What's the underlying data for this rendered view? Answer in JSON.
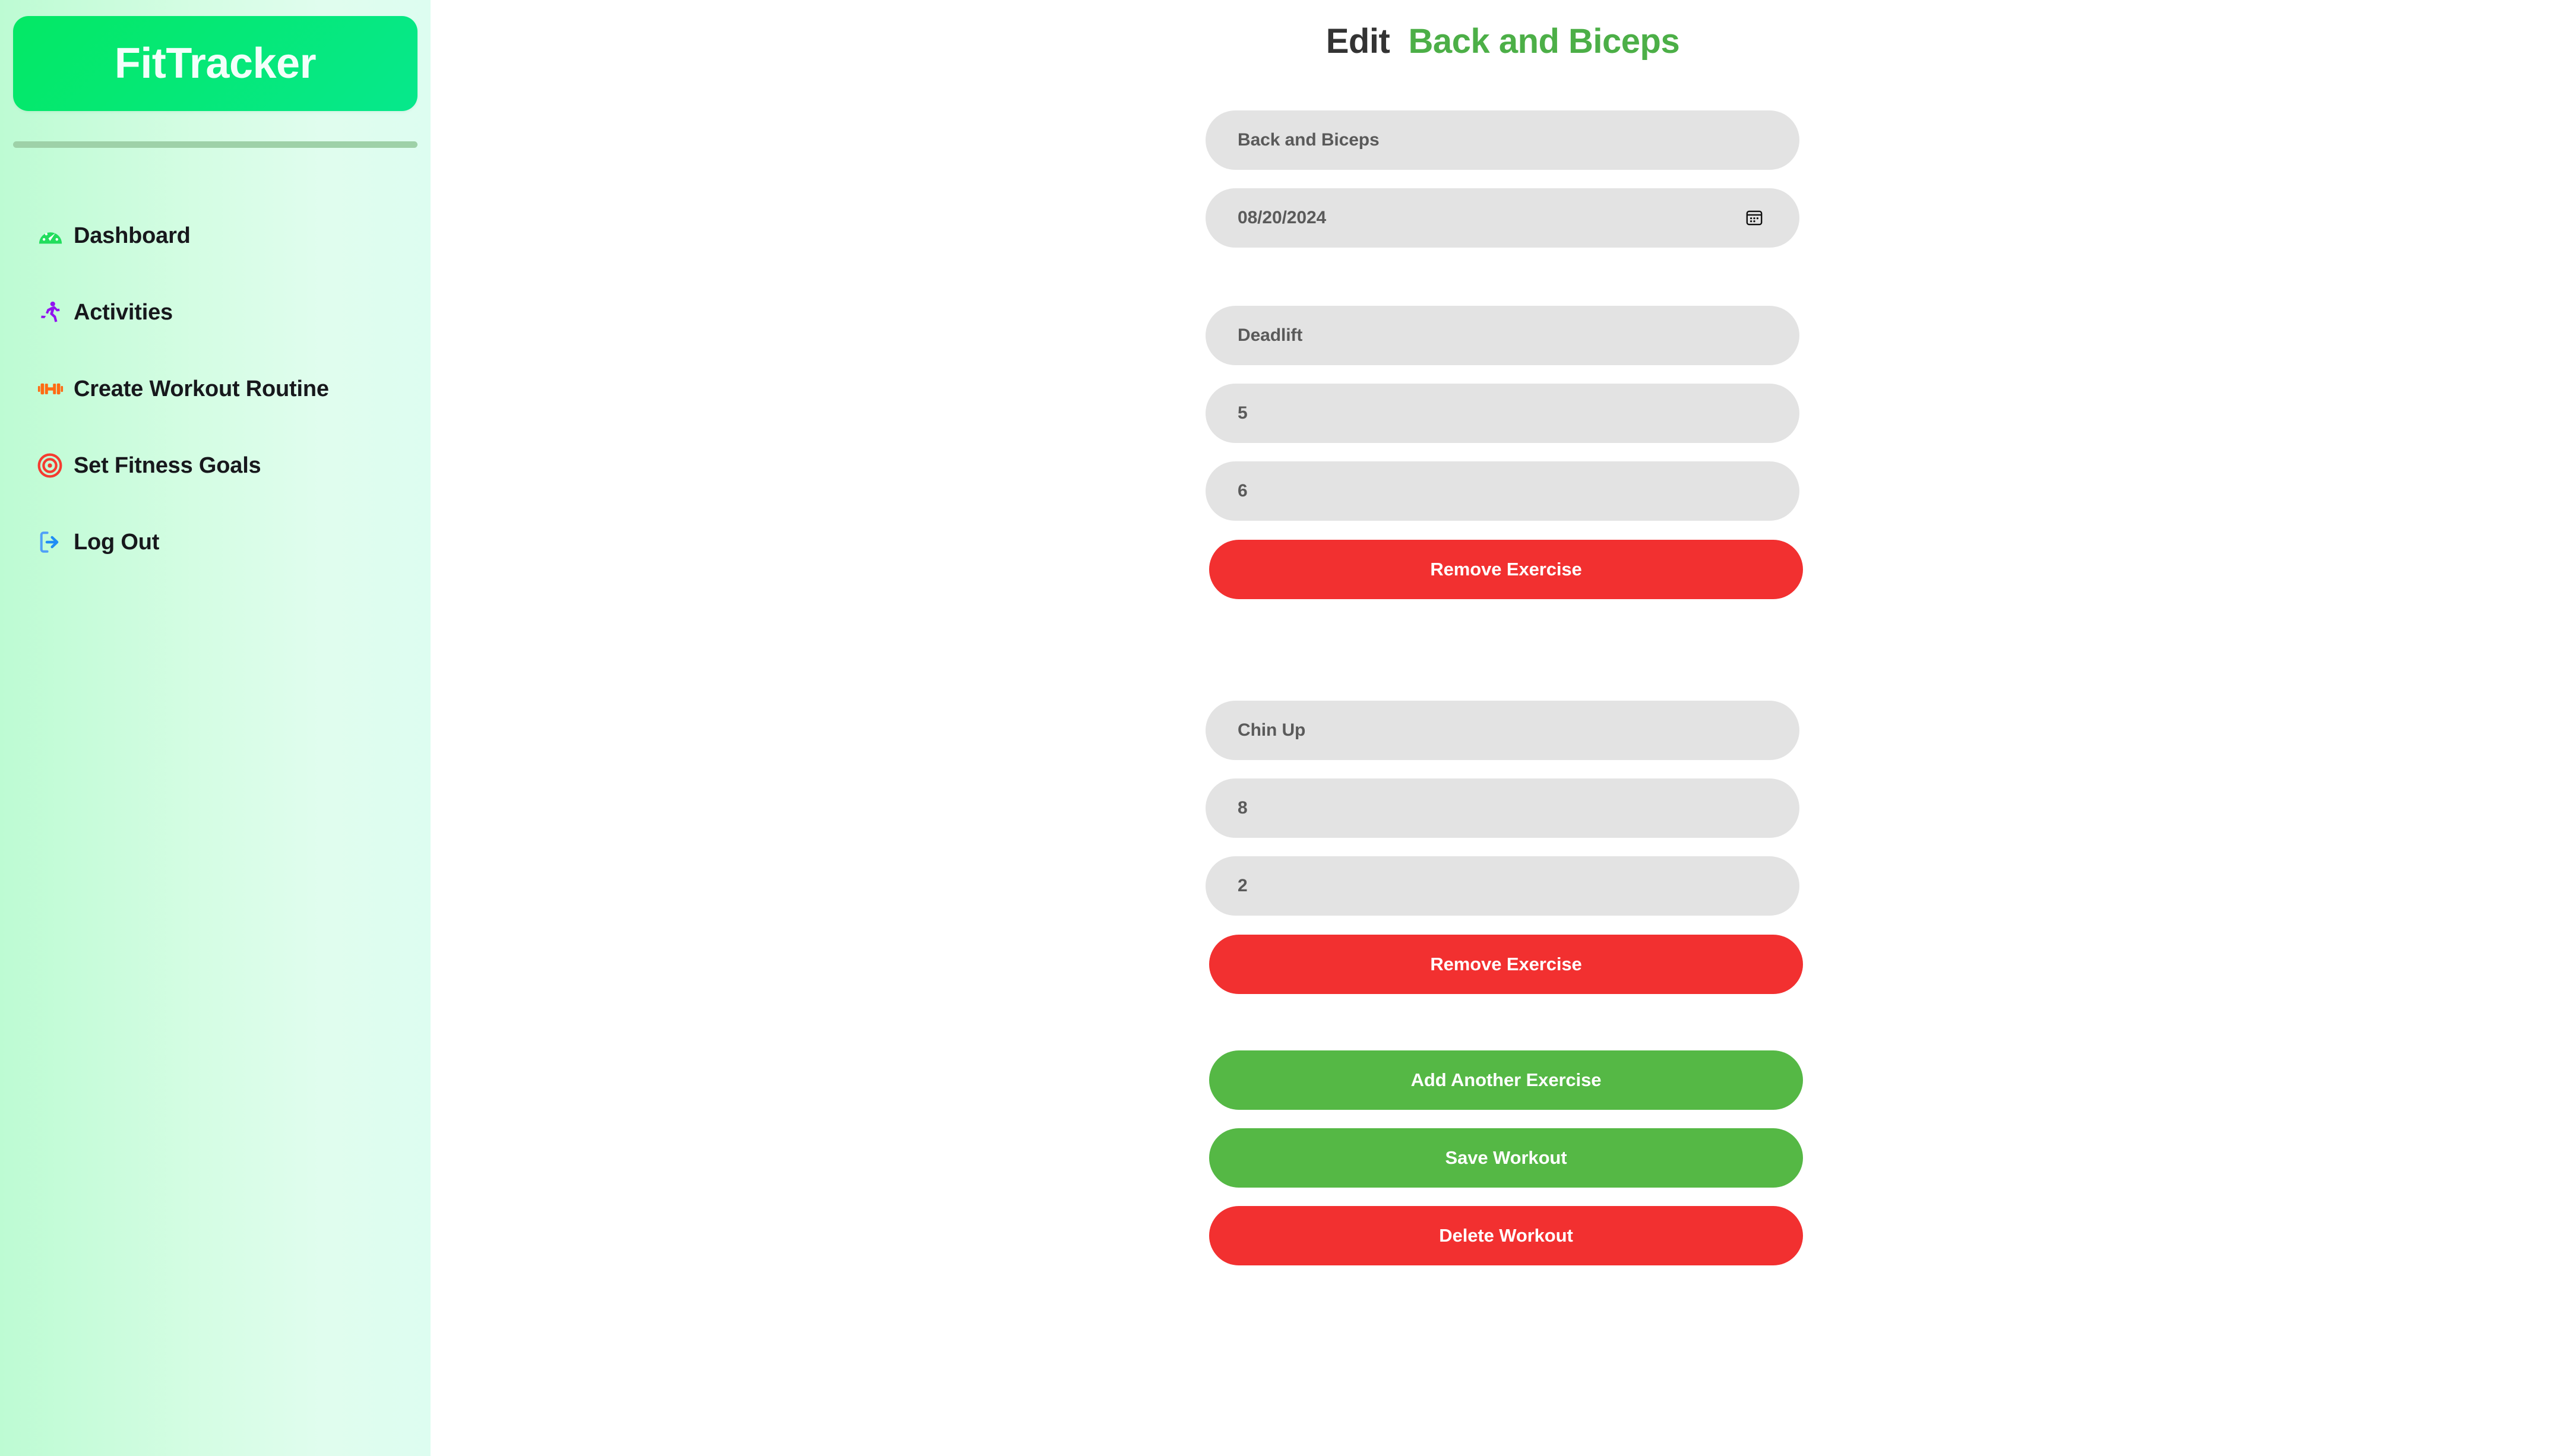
{
  "sidebar": {
    "logo": "FitTracker",
    "items": [
      {
        "label": "Dashboard",
        "icon": "gauge-icon"
      },
      {
        "label": "Activities",
        "icon": "running-person-icon"
      },
      {
        "label": "Create Workout Routine",
        "icon": "dumbbell-icon"
      },
      {
        "label": "Set Fitness Goals",
        "icon": "target-icon"
      },
      {
        "label": "Log Out",
        "icon": "logout-icon"
      }
    ]
  },
  "page": {
    "title_prefix": "Edit",
    "title_workout": "Back and Biceps"
  },
  "workout": {
    "name_value": "Back and Biceps",
    "date_value": "08/20/2024",
    "date_icon": "calendar-icon"
  },
  "exercises": [
    {
      "name_value": "Deadlift",
      "sets_value": "5",
      "reps_value": "6",
      "remove_label": "Remove Exercise"
    },
    {
      "name_value": "Chin Up",
      "sets_value": "8",
      "reps_value": "2",
      "remove_label": "Remove Exercise"
    }
  ],
  "actions": {
    "add_exercise_label": "Add Another Exercise",
    "save_label": "Save Workout",
    "delete_label": "Delete Workout"
  },
  "colors": {
    "brand_green": "#04e865",
    "title_green": "#4caf47",
    "button_green": "#55b845",
    "button_red": "#f23030",
    "field_gray": "#e3e3e3",
    "sidebar_gradient_start": "#bdfbd3",
    "sidebar_gradient_end": "#ddfdf0"
  }
}
